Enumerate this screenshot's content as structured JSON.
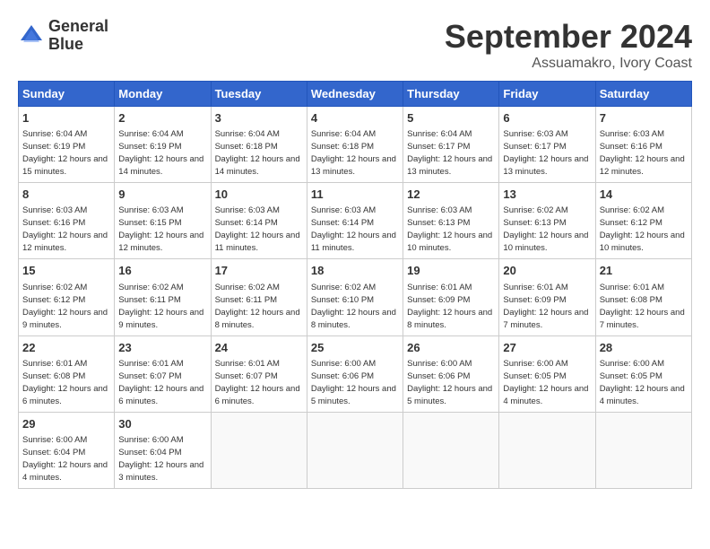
{
  "logo": {
    "line1": "General",
    "line2": "Blue"
  },
  "title": "September 2024",
  "location": "Assuamakro, Ivory Coast",
  "weekdays": [
    "Sunday",
    "Monday",
    "Tuesday",
    "Wednesday",
    "Thursday",
    "Friday",
    "Saturday"
  ],
  "weeks": [
    [
      {
        "day": "1",
        "sunrise": "6:04 AM",
        "sunset": "6:19 PM",
        "daylight": "12 hours and 15 minutes."
      },
      {
        "day": "2",
        "sunrise": "6:04 AM",
        "sunset": "6:19 PM",
        "daylight": "12 hours and 14 minutes."
      },
      {
        "day": "3",
        "sunrise": "6:04 AM",
        "sunset": "6:18 PM",
        "daylight": "12 hours and 14 minutes."
      },
      {
        "day": "4",
        "sunrise": "6:04 AM",
        "sunset": "6:18 PM",
        "daylight": "12 hours and 13 minutes."
      },
      {
        "day": "5",
        "sunrise": "6:04 AM",
        "sunset": "6:17 PM",
        "daylight": "12 hours and 13 minutes."
      },
      {
        "day": "6",
        "sunrise": "6:03 AM",
        "sunset": "6:17 PM",
        "daylight": "12 hours and 13 minutes."
      },
      {
        "day": "7",
        "sunrise": "6:03 AM",
        "sunset": "6:16 PM",
        "daylight": "12 hours and 12 minutes."
      }
    ],
    [
      {
        "day": "8",
        "sunrise": "6:03 AM",
        "sunset": "6:16 PM",
        "daylight": "12 hours and 12 minutes."
      },
      {
        "day": "9",
        "sunrise": "6:03 AM",
        "sunset": "6:15 PM",
        "daylight": "12 hours and 12 minutes."
      },
      {
        "day": "10",
        "sunrise": "6:03 AM",
        "sunset": "6:14 PM",
        "daylight": "12 hours and 11 minutes."
      },
      {
        "day": "11",
        "sunrise": "6:03 AM",
        "sunset": "6:14 PM",
        "daylight": "12 hours and 11 minutes."
      },
      {
        "day": "12",
        "sunrise": "6:03 AM",
        "sunset": "6:13 PM",
        "daylight": "12 hours and 10 minutes."
      },
      {
        "day": "13",
        "sunrise": "6:02 AM",
        "sunset": "6:13 PM",
        "daylight": "12 hours and 10 minutes."
      },
      {
        "day": "14",
        "sunrise": "6:02 AM",
        "sunset": "6:12 PM",
        "daylight": "12 hours and 10 minutes."
      }
    ],
    [
      {
        "day": "15",
        "sunrise": "6:02 AM",
        "sunset": "6:12 PM",
        "daylight": "12 hours and 9 minutes."
      },
      {
        "day": "16",
        "sunrise": "6:02 AM",
        "sunset": "6:11 PM",
        "daylight": "12 hours and 9 minutes."
      },
      {
        "day": "17",
        "sunrise": "6:02 AM",
        "sunset": "6:11 PM",
        "daylight": "12 hours and 8 minutes."
      },
      {
        "day": "18",
        "sunrise": "6:02 AM",
        "sunset": "6:10 PM",
        "daylight": "12 hours and 8 minutes."
      },
      {
        "day": "19",
        "sunrise": "6:01 AM",
        "sunset": "6:09 PM",
        "daylight": "12 hours and 8 minutes."
      },
      {
        "day": "20",
        "sunrise": "6:01 AM",
        "sunset": "6:09 PM",
        "daylight": "12 hours and 7 minutes."
      },
      {
        "day": "21",
        "sunrise": "6:01 AM",
        "sunset": "6:08 PM",
        "daylight": "12 hours and 7 minutes."
      }
    ],
    [
      {
        "day": "22",
        "sunrise": "6:01 AM",
        "sunset": "6:08 PM",
        "daylight": "12 hours and 6 minutes."
      },
      {
        "day": "23",
        "sunrise": "6:01 AM",
        "sunset": "6:07 PM",
        "daylight": "12 hours and 6 minutes."
      },
      {
        "day": "24",
        "sunrise": "6:01 AM",
        "sunset": "6:07 PM",
        "daylight": "12 hours and 6 minutes."
      },
      {
        "day": "25",
        "sunrise": "6:00 AM",
        "sunset": "6:06 PM",
        "daylight": "12 hours and 5 minutes."
      },
      {
        "day": "26",
        "sunrise": "6:00 AM",
        "sunset": "6:06 PM",
        "daylight": "12 hours and 5 minutes."
      },
      {
        "day": "27",
        "sunrise": "6:00 AM",
        "sunset": "6:05 PM",
        "daylight": "12 hours and 4 minutes."
      },
      {
        "day": "28",
        "sunrise": "6:00 AM",
        "sunset": "6:05 PM",
        "daylight": "12 hours and 4 minutes."
      }
    ],
    [
      {
        "day": "29",
        "sunrise": "6:00 AM",
        "sunset": "6:04 PM",
        "daylight": "12 hours and 4 minutes."
      },
      {
        "day": "30",
        "sunrise": "6:00 AM",
        "sunset": "6:04 PM",
        "daylight": "12 hours and 3 minutes."
      },
      null,
      null,
      null,
      null,
      null
    ]
  ]
}
